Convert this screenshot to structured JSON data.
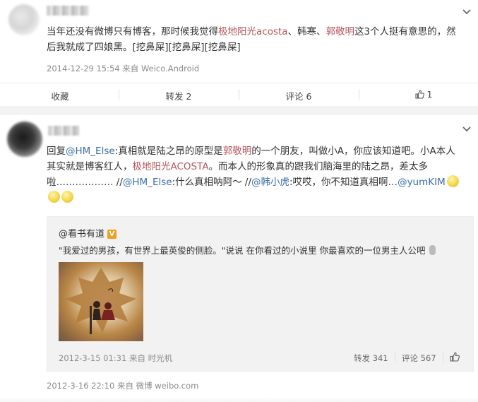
{
  "post1": {
    "text_a": "当年还没有微博只有博客，那时候我觉得",
    "name_acosta": "极地阳光acosta",
    "text_b": "、韩寒、",
    "name_guo": "郭敬明",
    "text_c": "这3个人挺有意思的，然",
    "text_d": "后我就成了四娘黑。[挖鼻屎][挖鼻屎][挖鼻屎]",
    "meta": "2014-12-29 15:54 来自 Weico.Android",
    "actions": {
      "fav": "收藏",
      "repost": "转发 2",
      "comment": "评论 6",
      "like": "1"
    }
  },
  "post2": {
    "reply_prefix": "回复",
    "mention_1": "@HM_Else",
    "text_a": ":真相就是陆之昂的原型是",
    "name_guo": "郭敬明",
    "text_b": "的一个朋友，叫做小A，你应该知道吧。小A本人",
    "text_c": "其实就是博客红人，",
    "name_acosta": "极地阳光ACOSTA",
    "text_d": "。而本人的形象真的跟我们脑海里的陆之昂，差太多",
    "text_e": "啦……………… //",
    "mention_2": "@HM_Else",
    "text_f": ":什么真相呐阿～ //",
    "mention_3": "@韩小虎",
    "text_g": ":哎哎，你不知道真相啊…",
    "mention_4": "@yumKIM",
    "quote": {
      "author": "@看书有道",
      "badge": "V",
      "text": "\"我爱过的男孩，有世界上最英俊的侧脸。\"说说 在你看过的小说里 你最喜欢的一位男主人公吧",
      "meta": "2012-3-15 01:31 来自 时光机",
      "repost": "转发 341",
      "comment": "评论 567"
    },
    "meta": "2012-3-16 22:10 来自 微博 weibo.com"
  },
  "colors": {
    "link": "#3b6ea8",
    "highlight_name": "#b5545c",
    "meta_gray": "#8b8b8b",
    "quote_bg": "#f2f2f2"
  },
  "icons": {
    "chevron": "chevron-down-icon",
    "like": "thumbs-up-icon",
    "emoji": "face-emoji-icon"
  }
}
